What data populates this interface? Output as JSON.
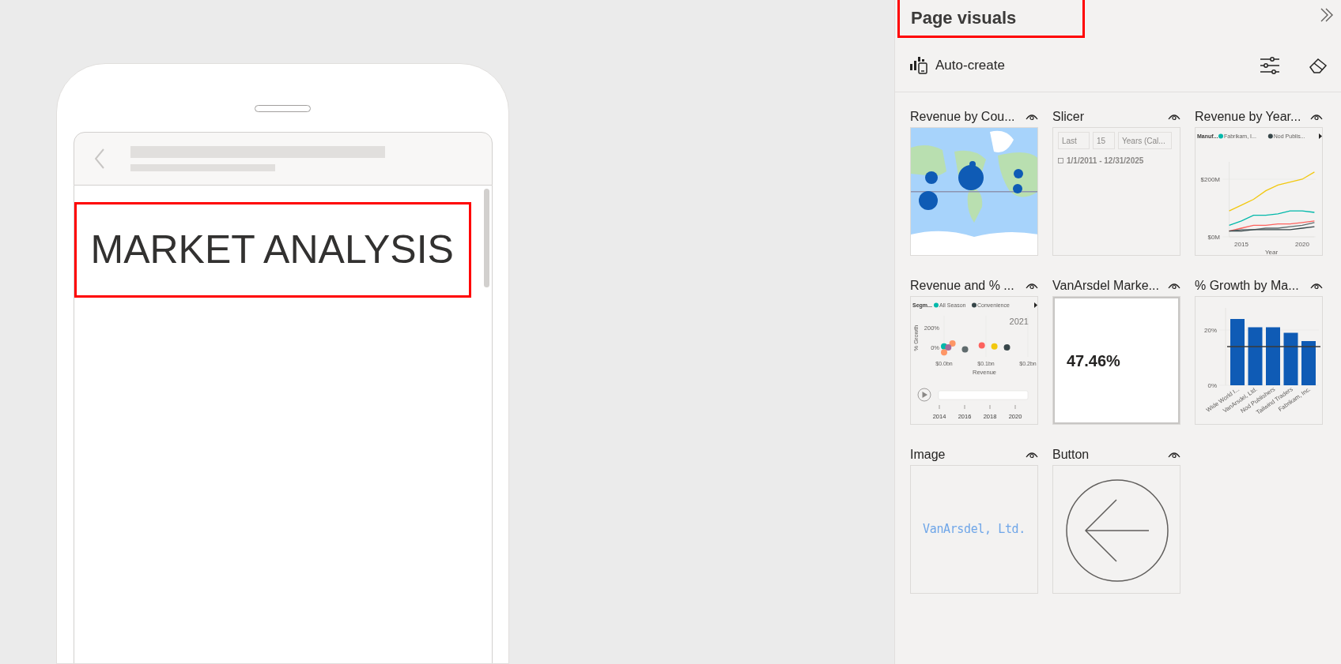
{
  "phone": {
    "title": "MARKET ANALYSIS"
  },
  "panel": {
    "title": "Page visuals",
    "auto_create": "Auto-create"
  },
  "visuals": [
    {
      "kind": "map",
      "title": "Revenue by Cou..."
    },
    {
      "kind": "slicer",
      "title": "Slicer",
      "fields": [
        "Last",
        "15",
        "Years (Cal..."
      ],
      "range": "1/1/2011 - 12/31/2025"
    },
    {
      "kind": "chart",
      "title": "Revenue by Year...",
      "chart_data": {
        "type": "line",
        "xlabel": "Year",
        "legend": {
          "title": "Manuf..."
        },
        "x": [
          2014,
          2015,
          2016,
          2017,
          2018,
          2019,
          2020,
          2021
        ],
        "xlim": [
          2014,
          2021
        ],
        "ylim": [
          0,
          260
        ],
        "xticks": [
          2015,
          2020
        ],
        "yticks": [
          {
            "value": 0,
            "label": "$0M"
          },
          {
            "value": 200,
            "label": "$200M"
          }
        ],
        "series": [
          {
            "color": "#f2c80f",
            "values": [
              90,
              110,
              130,
              160,
              180,
              190,
              200,
              225
            ]
          },
          {
            "name": "Fabrikam, I...",
            "color": "#01b8aa",
            "values": [
              40,
              55,
              75,
              75,
              80,
              90,
              90,
              85
            ]
          },
          {
            "color": "#fd625e",
            "values": [
              20,
              30,
              40,
              40,
              45,
              45,
              50,
              55
            ]
          },
          {
            "color": "#5f6b6d",
            "values": [
              20,
              25,
              25,
              30,
              30,
              35,
              40,
              50
            ]
          },
          {
            "name": "Nod Publis...",
            "color": "#374649",
            "values": [
              20,
              20,
              25,
              25,
              25,
              25,
              30,
              35
            ]
          }
        ]
      }
    },
    {
      "kind": "chart",
      "title": "Revenue and % ...",
      "play_year": "2021",
      "play_ticks": [
        "2014",
        "2016",
        "2018",
        "2020"
      ],
      "chart_data": {
        "type": "scatter",
        "xlabel": "Revenue",
        "ylabel": "% Growth",
        "legend": {
          "title": "Segm..."
        },
        "xlim": [
          0,
          0.2
        ],
        "ylim": [
          -100,
          300
        ],
        "xticks": [
          {
            "value": 0,
            "label": "$0.0bn"
          },
          {
            "value": 0.1,
            "label": "$0.1bn"
          },
          {
            "value": 0.2,
            "label": "$0.2bn"
          }
        ],
        "yticks": [
          {
            "value": 0,
            "label": "0%"
          },
          {
            "value": 200,
            "label": "200%"
          }
        ],
        "series": [
          {
            "name": "All Season",
            "color": "#01b8aa",
            "x": [
              0.0
            ],
            "values": [
              10
            ]
          },
          {
            "name": "Convenience",
            "color": "#374649",
            "x": [
              0.15
            ],
            "values": [
              0
            ]
          },
          {
            "color": "#fe9666",
            "x": [
              0.02,
              0.0
            ],
            "values": [
              40,
              -50
            ]
          },
          {
            "color": "#a66999",
            "x": [
              0.01
            ],
            "values": [
              0
            ]
          },
          {
            "color": "#5f6b6d",
            "x": [
              0.05
            ],
            "values": [
              -20
            ]
          },
          {
            "color": "#fd625e",
            "x": [
              0.09
            ],
            "values": [
              20
            ]
          },
          {
            "color": "#f2c80f",
            "x": [
              0.12
            ],
            "values": [
              10
            ]
          }
        ]
      }
    },
    {
      "kind": "card",
      "title": "VanArsdel Marke...",
      "value": "47.46%"
    },
    {
      "kind": "chart",
      "title": "% Growth by Ma...",
      "chart_data": {
        "type": "bar",
        "categories": [
          "Wide World I...",
          "VanArsdel, Ltd.",
          "Nod Publishers",
          "Tailwind Traders",
          "Fabrikam, Inc."
        ],
        "ylim": [
          0,
          28
        ],
        "yticks": [
          {
            "value": 0,
            "label": "0%"
          },
          {
            "value": 20,
            "label": "20%"
          }
        ],
        "series": [
          {
            "color": "#0f5bb5",
            "values": [
              24,
              21,
              21,
              19,
              16
            ]
          },
          {
            "type": "line",
            "color": "#3b3a39",
            "values": [
              14,
              14,
              14,
              14,
              14
            ]
          }
        ]
      }
    },
    {
      "title": "Image",
      "text": "VanArsdel, Ltd."
    },
    {
      "kind": "button",
      "title": "Button"
    }
  ]
}
